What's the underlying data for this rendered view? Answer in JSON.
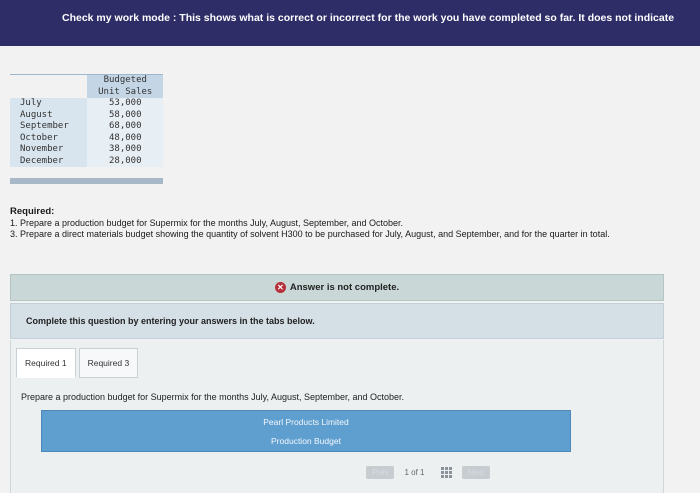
{
  "banner": {
    "text": "Check my work mode : This shows what is correct or incorrect for the work you have completed so far. It does not indicate"
  },
  "table": {
    "header_line1": "Budgeted",
    "header_line2": "Unit Sales",
    "rows": [
      {
        "month": "July",
        "value": "53,000"
      },
      {
        "month": "August",
        "value": "58,000"
      },
      {
        "month": "September",
        "value": "68,000"
      },
      {
        "month": "October",
        "value": "48,000"
      },
      {
        "month": "November",
        "value": "38,000"
      },
      {
        "month": "December",
        "value": "28,000"
      }
    ]
  },
  "required": {
    "heading": "Required:",
    "item1": "1. Prepare a production budget for Supermix for the months July, August, September, and October.",
    "item3": "3. Prepare a direct materials budget showing the quantity of solvent H300 to be purchased for July, August, and September, and for the quarter in total."
  },
  "answer_status": "Answer is not complete.",
  "instruction": "Complete this question by entering your answers in the tabs below.",
  "tabs": [
    {
      "label": "Required 1"
    },
    {
      "label": "Required 3"
    }
  ],
  "tab_description": "Prepare a production budget for Supermix for the months July, August, September, and October.",
  "budget_box": {
    "company": "Pearl Products Limited",
    "title": "Production Budget"
  },
  "pager": {
    "prev": "Prev",
    "current": "1",
    "of_label": "of",
    "total": "1",
    "next": "Next"
  }
}
